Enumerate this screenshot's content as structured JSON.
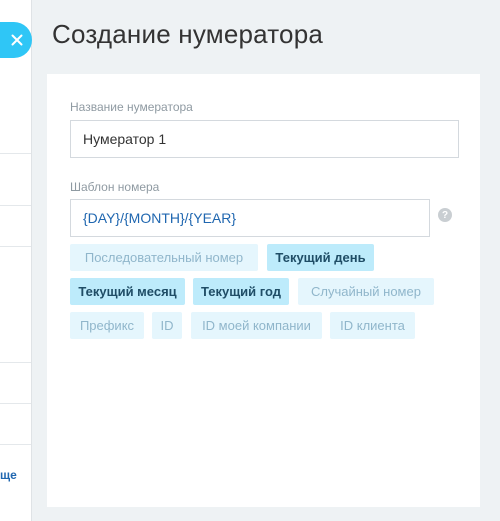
{
  "background_page": {
    "partial_link_text": "ще"
  },
  "slider": {
    "title": "Создание нумератора",
    "close_icon": "close-icon"
  },
  "form": {
    "name_label": "Название нумератора",
    "name_value": "Нумератор 1",
    "template_label": "Шаблон номера",
    "template_value": "{DAY}/{MONTH}/{YEAR}",
    "help_icon": "question-icon",
    "help_glyph": "?"
  },
  "chips": [
    {
      "label": "Последовательный номер",
      "active": false
    },
    {
      "label": "Текущий день",
      "active": true
    },
    {
      "label": "Текущий месяц",
      "active": true
    },
    {
      "label": "Текущий год",
      "active": true
    },
    {
      "label": "Случайный номер",
      "active": false
    },
    {
      "label": "Префикс",
      "active": false
    },
    {
      "label": "ID",
      "active": false
    },
    {
      "label": "ID моей компании",
      "active": false
    },
    {
      "label": "ID клиента",
      "active": false
    }
  ],
  "colors": {
    "accent": "#2fc6f6",
    "chip_active_bg": "#bdebfb",
    "chip_inactive_bg": "#e5f6fd",
    "link": "#2067b0"
  }
}
